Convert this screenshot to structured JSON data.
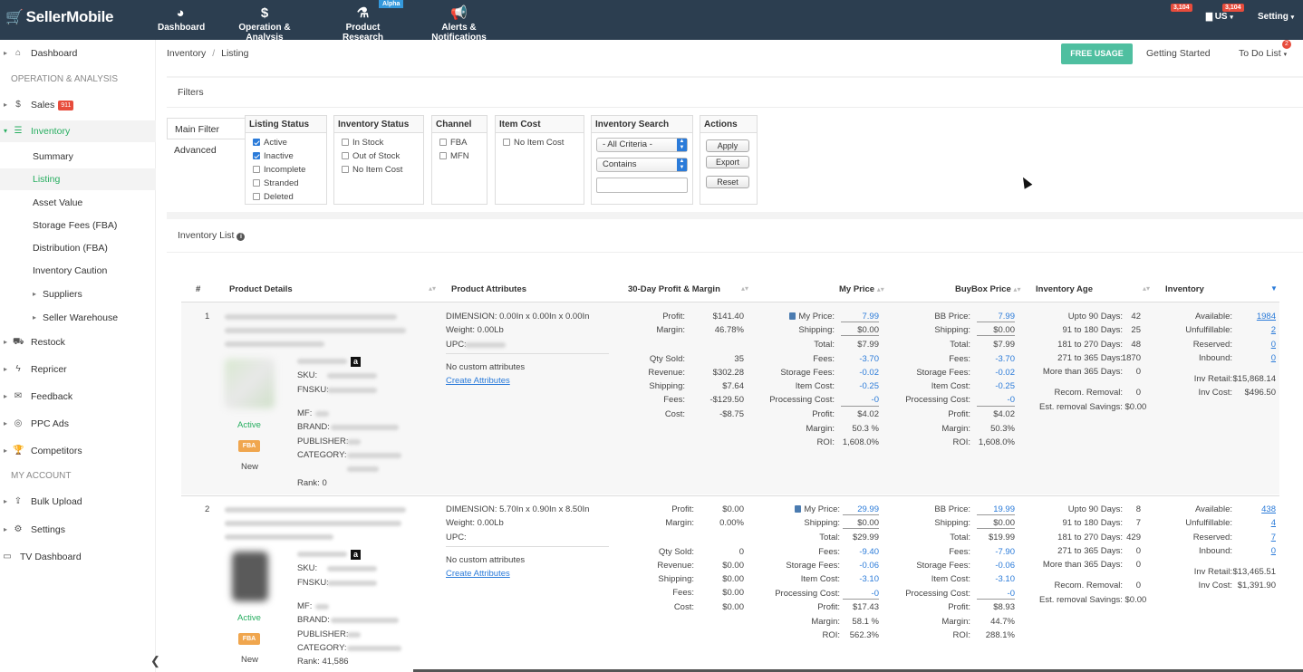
{
  "topbar": {
    "brand": "SellerMobile",
    "nav": [
      {
        "label": "Dashboard",
        "icon": "pie-chart-icon"
      },
      {
        "label": "Operation & Analysis",
        "icon": "dollar-icon"
      },
      {
        "label": "Product Research",
        "icon": "flask-icon"
      },
      {
        "label": "Alerts & Notifications",
        "icon": "megaphone-icon"
      }
    ],
    "alpha": "Alpha",
    "badge1": "3,104",
    "badge2": "3,104",
    "country": "US",
    "setting": "Setting"
  },
  "sidebar": {
    "dashboard": "Dashboard",
    "sec_ops": "OPERATION & ANALYSIS",
    "sales": "Sales",
    "sales_badge": "911",
    "inventory": "Inventory",
    "summary": "Summary",
    "listing": "Listing",
    "asset_value": "Asset Value",
    "storage_fees": "Storage Fees (FBA)",
    "distribution": "Distribution (FBA)",
    "caution": "Inventory Caution",
    "suppliers": "Suppliers",
    "seller_warehouse": "Seller Warehouse",
    "restock": "Restock",
    "repricer": "Repricer",
    "feedback": "Feedback",
    "ppc": "PPC Ads",
    "competitors": "Competitors",
    "sec_account": "MY ACCOUNT",
    "bulk_upload": "Bulk Upload",
    "settings": "Settings",
    "tv": "TV Dashboard"
  },
  "header": {
    "crumb1": "Inventory",
    "crumb2": "Listing",
    "free": "FREE USAGE",
    "getting_started": "Getting Started",
    "todo": "To Do List",
    "todo_badge": "2"
  },
  "filters": {
    "title": "Filters",
    "tab_main": "Main Filter",
    "tab_adv": "Advanced",
    "listing_status": {
      "title": "Listing Status",
      "items": [
        "Active",
        "Inactive",
        "Incomplete",
        "Stranded",
        "Deleted"
      ]
    },
    "inventory_status": {
      "title": "Inventory Status",
      "items": [
        "In Stock",
        "Out of Stock",
        "No Item Cost"
      ]
    },
    "channel": {
      "title": "Channel",
      "items": [
        "FBA",
        "MFN"
      ]
    },
    "item_cost": {
      "title": "Item Cost",
      "items": [
        "No Item Cost"
      ]
    },
    "inventory_search": {
      "title": "Inventory Search",
      "criteria": "- All Criteria -",
      "match": "Contains"
    },
    "actions": {
      "title": "Actions",
      "apply": "Apply",
      "export": "Export",
      "reset": "Reset"
    }
  },
  "list": {
    "title": "Inventory List",
    "headers": {
      "num": "#",
      "details": "Product Details",
      "attrs": "Product Attributes",
      "profit": "30-Day Profit & Margin",
      "myprice": "My Price",
      "buybox": "BuyBox Price",
      "age": "Inventory Age",
      "inventory": "Inventory"
    },
    "labels": {
      "sku": "SKU:",
      "fnsku": "FNSKU:",
      "mf": "MF:",
      "brand": "BRAND:",
      "publisher": "PUBLISHER:",
      "category": "CATEGORY:",
      "no_custom": "No custom attributes",
      "create": "Create Attributes",
      "profit": "Profit:",
      "margin": "Margin:",
      "qty": "Qty Sold:",
      "revenue": "Revenue:",
      "shipping": "Shipping:",
      "fees": "Fees:",
      "cost": "Cost:",
      "my_price": "My Price:",
      "total": "Total:",
      "storage": "Storage Fees:",
      "item_cost": "Item Cost:",
      "processing": "Processing Cost:",
      "roi": "ROI:",
      "bb_price": "BB Price:",
      "a90": "Upto 90 Days:",
      "a180": "91 to 180 Days:",
      "a270": "181 to 270 Days:",
      "a365": "271 to 365 Days:",
      "amore": "More than 365 Days:",
      "recom": "Recom. Removal:",
      "savings": "Est. removal Savings:",
      "available": "Available:",
      "unfulfillable": "Unfulfillable:",
      "reserved": "Reserved:",
      "inbound": "Inbound:",
      "inv_retail": "Inv Retail:",
      "inv_cost": "Inv Cost:",
      "status": "Active",
      "fba": "FBA",
      "cond": "New"
    },
    "rows": [
      {
        "num": "1",
        "dimension": "DIMENSION: 0.00In x 0.00In x 0.00In",
        "weight": "Weight: 0.00Lb",
        "upc": "UPC:",
        "rank": "Rank: 0",
        "profit": "$141.40",
        "margin": "46.78%",
        "qty": "35",
        "revenue": "$302.28",
        "shipping": "$7.64",
        "fees": "-$129.50",
        "cost": "-$8.75",
        "mp": {
          "price": "7.99",
          "ship": "$0.00",
          "total": "$7.99",
          "fees": "-3.70",
          "storage": "-0.02",
          "item": "-0.25",
          "proc": "-0",
          "profit": "$4.02",
          "margin": "50.3 %",
          "roi": "1,608.0%"
        },
        "bb": {
          "price": "7.99",
          "ship": "$0.00",
          "total": "$7.99",
          "fees": "-3.70",
          "storage": "-0.02",
          "item": "-0.25",
          "proc": "-0",
          "profit": "$4.02",
          "margin": "50.3%",
          "roi": "1,608.0%"
        },
        "age": {
          "a90": "42",
          "a180": "25",
          "a270": "48",
          "a365": "1870",
          "amore": "0",
          "recom": "0",
          "savings": "$0.00"
        },
        "inv": {
          "available": "1984",
          "unfulfillable": "2",
          "reserved": "0",
          "inbound": "0",
          "retail": "$15,868.14",
          "cost": "$496.50"
        }
      },
      {
        "num": "2",
        "dimension": "DIMENSION: 5.70In x 0.90In x 8.50In",
        "weight": "Weight: 0.00Lb",
        "upc": "UPC:",
        "rank": "Rank: 41,586",
        "profit": "$0.00",
        "margin": "0.00%",
        "qty": "0",
        "revenue": "$0.00",
        "shipping": "$0.00",
        "fees": "$0.00",
        "cost": "$0.00",
        "mp": {
          "price": "29.99",
          "ship": "$0.00",
          "total": "$29.99",
          "fees": "-9.40",
          "storage": "-0.06",
          "item": "-3.10",
          "proc": "-0",
          "profit": "$17.43",
          "margin": "58.1 %",
          "roi": "562.3%"
        },
        "bb": {
          "price": "19.99",
          "ship": "$0.00",
          "total": "$19.99",
          "fees": "-7.90",
          "storage": "-0.06",
          "item": "-3.10",
          "proc": "-0",
          "profit": "$8.93",
          "margin": "44.7%",
          "roi": "288.1%"
        },
        "age": {
          "a90": "8",
          "a180": "7",
          "a270": "429",
          "a365": "0",
          "amore": "0",
          "recom": "0",
          "savings": "$0.00"
        },
        "inv": {
          "available": "438",
          "unfulfillable": "4",
          "reserved": "7",
          "inbound": "0",
          "retail": "$13,465.51",
          "cost": "$1,391.90"
        }
      }
    ]
  }
}
